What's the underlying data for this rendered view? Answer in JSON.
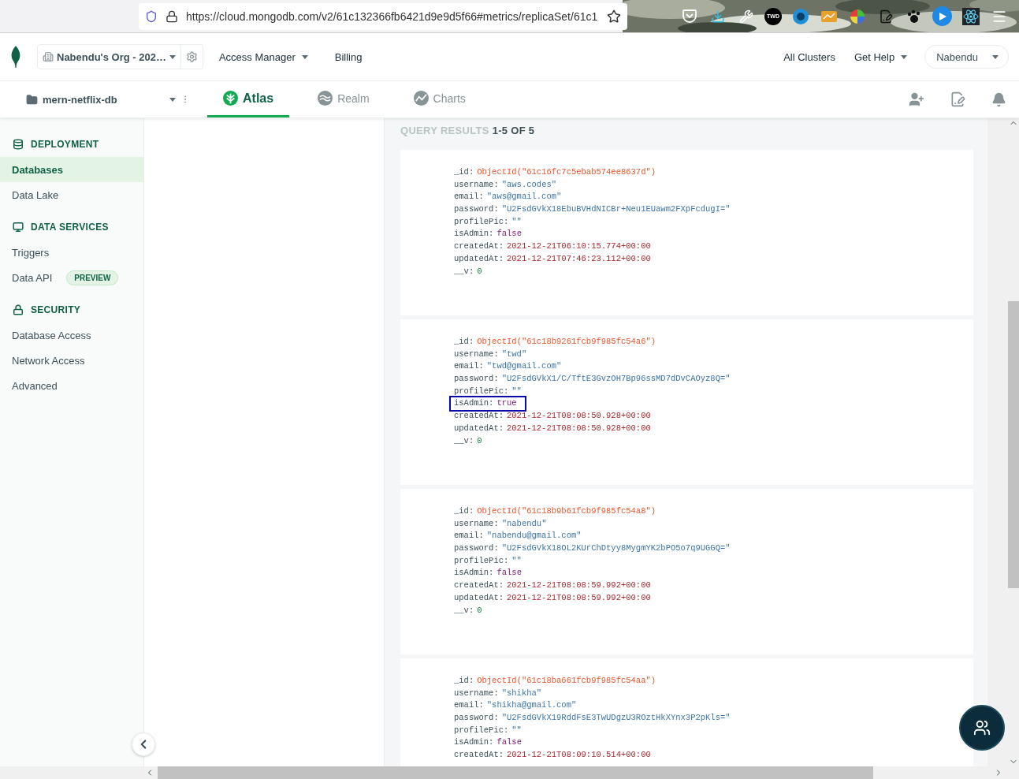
{
  "browser": {
    "url": "https://cloud.mongodb.com/v2/61c132366fb6421d9e9d5f66#metrics/replicaSet/61c1",
    "extension_badge": "TWD"
  },
  "header": {
    "org": "Nabendu's Org - 202…",
    "links": [
      {
        "label": "Access Manager",
        "dropdown": true
      },
      {
        "label": "Billing",
        "dropdown": false
      }
    ],
    "right_links": [
      {
        "label": "All Clusters",
        "dropdown": false
      },
      {
        "label": "Get Help",
        "dropdown": true
      }
    ],
    "user": "Nabendu"
  },
  "project": {
    "name": "mern-netflix-db",
    "tabs": [
      {
        "label": "Atlas",
        "kind": "atlas",
        "selected": true
      },
      {
        "label": "Realm",
        "kind": "realm",
        "selected": false
      },
      {
        "label": "Charts",
        "kind": "charts",
        "selected": false
      }
    ]
  },
  "sidebar": {
    "sections": [
      {
        "title": "DEPLOYMENT",
        "kind": "database",
        "items": [
          {
            "label": "Databases",
            "selected": true
          },
          {
            "label": "Data Lake",
            "selected": false
          }
        ]
      },
      {
        "title": "DATA SERVICES",
        "kind": "monitor",
        "items": [
          {
            "label": "Triggers",
            "selected": false
          },
          {
            "label": "Data API",
            "selected": false,
            "badge": "PREVIEW"
          }
        ]
      },
      {
        "title": "SECURITY",
        "kind": "lock",
        "items": [
          {
            "label": "Database Access",
            "selected": false
          },
          {
            "label": "Network Access",
            "selected": false
          },
          {
            "label": "Advanced",
            "selected": false
          }
        ]
      }
    ]
  },
  "results": {
    "title": "QUERY RESULTS",
    "range": "1-5 OF 5",
    "documents": [
      {
        "fields": [
          {
            "key": "_id:",
            "value": "ObjectId(\"61c16fc7c5ebab574ee8637d\")",
            "kind": "objectid",
            "highlighted": false
          },
          {
            "key": "username:",
            "value": "\"aws.codes\"",
            "kind": "string",
            "highlighted": false
          },
          {
            "key": "email:",
            "value": "\"aws@gmail.com\"",
            "kind": "string",
            "highlighted": false
          },
          {
            "key": "password:",
            "value": "\"U2FsdGVkX18EbuBVHdNICBr+Neu1EUawm2FXpFcdugI=\"",
            "kind": "string",
            "highlighted": false
          },
          {
            "key": "profilePic:",
            "value": "\"\"",
            "kind": "string",
            "highlighted": false
          },
          {
            "key": "isAdmin:",
            "value": "false",
            "kind": "boolean",
            "highlighted": false
          },
          {
            "key": "createdAt:",
            "value": "2021-12-21T06:10:15.774+00:00",
            "kind": "date",
            "highlighted": false
          },
          {
            "key": "updatedAt:",
            "value": "2021-12-21T07:46:23.112+00:00",
            "kind": "date",
            "highlighted": false
          },
          {
            "key": "__v:",
            "value": "0",
            "kind": "number",
            "highlighted": false
          }
        ]
      },
      {
        "fields": [
          {
            "key": "_id:",
            "value": "ObjectId(\"61c18b9261fcb9f985fc54a6\")",
            "kind": "objectid",
            "highlighted": false
          },
          {
            "key": "username:",
            "value": "\"twd\"",
            "kind": "string",
            "highlighted": false
          },
          {
            "key": "email:",
            "value": "\"twd@gmail.com\"",
            "kind": "string",
            "highlighted": false
          },
          {
            "key": "password:",
            "value": "\"U2FsdGVkX1/C/TftE3GvzOH7Bp96ssMD7dDvCAOyz8Q=\"",
            "kind": "string",
            "highlighted": false
          },
          {
            "key": "profilePic:",
            "value": "\"\"",
            "kind": "string",
            "highlighted": false
          },
          {
            "key": "isAdmin:",
            "value": "true",
            "kind": "boolean",
            "highlighted": true
          },
          {
            "key": "createdAt:",
            "value": "2021-12-21T08:08:50.928+00:00",
            "kind": "date",
            "highlighted": false
          },
          {
            "key": "updatedAt:",
            "value": "2021-12-21T08:08:50.928+00:00",
            "kind": "date",
            "highlighted": false
          },
          {
            "key": "__v:",
            "value": "0",
            "kind": "number",
            "highlighted": false
          }
        ]
      },
      {
        "fields": [
          {
            "key": "_id:",
            "value": "ObjectId(\"61c18b9b61fcb9f985fc54a8\")",
            "kind": "objectid",
            "highlighted": false
          },
          {
            "key": "username:",
            "value": "\"nabendu\"",
            "kind": "string",
            "highlighted": false
          },
          {
            "key": "email:",
            "value": "\"nabendu@gmail.com\"",
            "kind": "string",
            "highlighted": false
          },
          {
            "key": "password:",
            "value": "\"U2FsdGVkX18OL2KUrChDtyy8MygmYK2bPO5o7q9UGGQ=\"",
            "kind": "string",
            "highlighted": false
          },
          {
            "key": "profilePic:",
            "value": "\"\"",
            "kind": "string",
            "highlighted": false
          },
          {
            "key": "isAdmin:",
            "value": "false",
            "kind": "boolean",
            "highlighted": false
          },
          {
            "key": "createdAt:",
            "value": "2021-12-21T08:08:59.992+00:00",
            "kind": "date",
            "highlighted": false
          },
          {
            "key": "updatedAt:",
            "value": "2021-12-21T08:08:59.992+00:00",
            "kind": "date",
            "highlighted": false
          },
          {
            "key": "__v:",
            "value": "0",
            "kind": "number",
            "highlighted": false
          }
        ]
      },
      {
        "fields": [
          {
            "key": "_id:",
            "value": "ObjectId(\"61c18ba661fcb9f985fc54aa\")",
            "kind": "objectid",
            "highlighted": false
          },
          {
            "key": "username:",
            "value": "\"shikha\"",
            "kind": "string",
            "highlighted": false
          },
          {
            "key": "email:",
            "value": "\"shikha@gmail.com\"",
            "kind": "string",
            "highlighted": false
          },
          {
            "key": "password:",
            "value": "\"U2FsdGVkX19RddFsE3TwUDgzU3ROztHkXYnx3P2pKls=\"",
            "kind": "string",
            "highlighted": false
          },
          {
            "key": "profilePic:",
            "value": "\"\"",
            "kind": "string",
            "highlighted": false
          },
          {
            "key": "isAdmin:",
            "value": "false",
            "kind": "boolean",
            "highlighted": false
          },
          {
            "key": "createdAt:",
            "value": "2021-12-21T08:09:10.514+00:00",
            "kind": "date",
            "highlighted": false
          }
        ]
      }
    ]
  }
}
